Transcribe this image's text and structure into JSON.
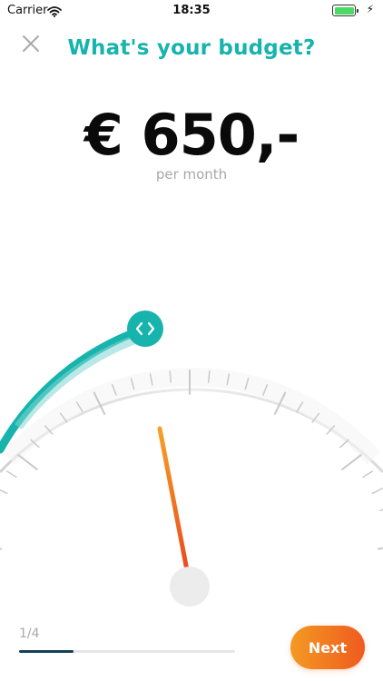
{
  "status_bar": {
    "carrier": "Carrier",
    "time": "18:35",
    "icons": [
      "wifi-icon",
      "battery-icon",
      "charging-icon"
    ]
  },
  "header": {
    "close_icon": "close-icon",
    "title": "What's your budget?"
  },
  "budget": {
    "amount": "€ 650,-",
    "period": "per month"
  },
  "gauge": {
    "slider_icon": "chevron-left-right-icon",
    "level_fraction": 0.32
  },
  "footer": {
    "step": "1/4",
    "progress_fraction": 0.25,
    "next_label": "Next"
  },
  "colors": {
    "accent": "#17b3ad",
    "needle": "#ee5622",
    "button_start": "#f49a22",
    "button_end": "#ef5a20",
    "progress": "#173f59"
  }
}
